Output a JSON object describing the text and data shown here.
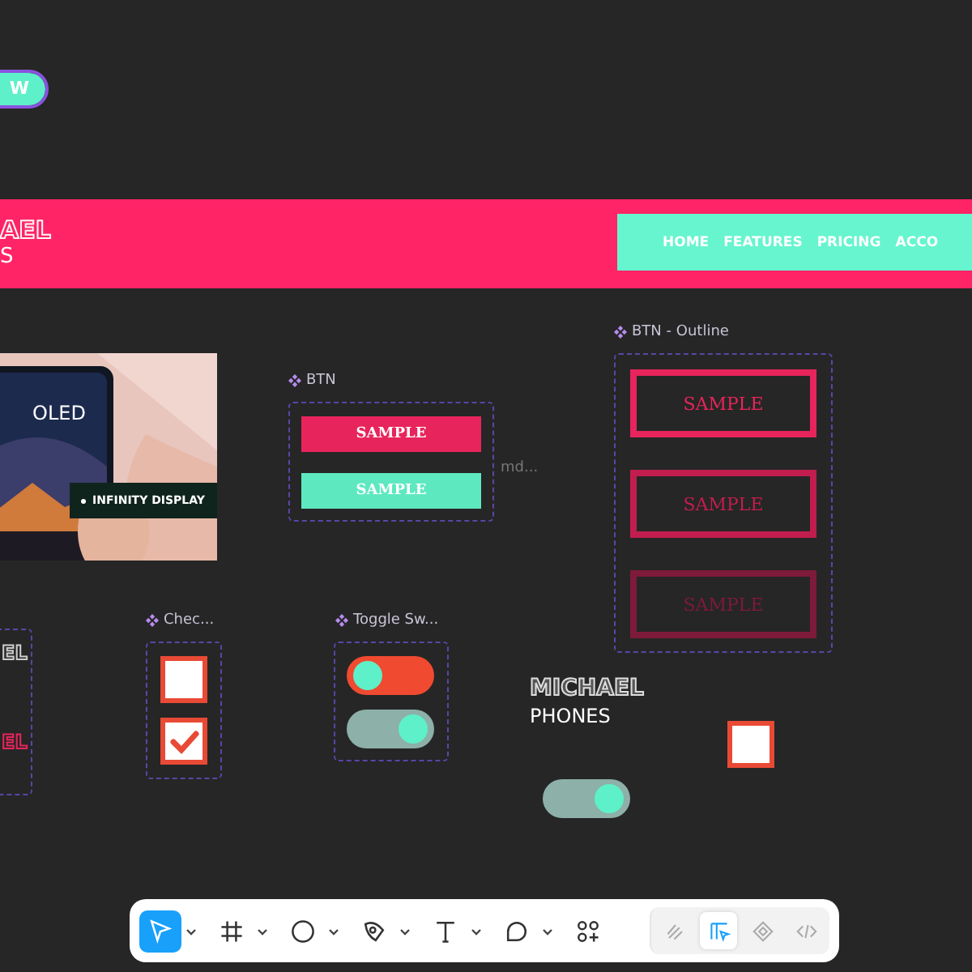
{
  "chip": {
    "label": "W",
    "selected": true
  },
  "header": {
    "logo_top": "AEL",
    "logo_bottom": "S",
    "nav": [
      "HOME",
      "FEATURES",
      "PRICING",
      "ACCO"
    ]
  },
  "banner": {
    "kind": "picture",
    "title": "OLED",
    "badge": "INFINITY DISPLAY"
  },
  "left_frame": {
    "texts": [
      {
        "label": "EL",
        "kind": "outline"
      },
      {
        "label": "EL",
        "kind": "pink"
      }
    ]
  },
  "btn_component": {
    "label": "BTN",
    "buttons": [
      {
        "label": "SAMPLE",
        "kind": "pink"
      },
      {
        "label": "SAMPLE",
        "kind": "teal"
      }
    ],
    "side_note": "md..."
  },
  "outline_component": {
    "label": "BTN - Outline",
    "buttons": [
      {
        "label": "SAMPLE",
        "kind": "strong"
      },
      {
        "label": "SAMPLE",
        "kind": "medium"
      },
      {
        "label": "SAMPLE",
        "kind": "faint"
      }
    ]
  },
  "checkbox_component": {
    "label": "Chec...",
    "boxes": [
      {
        "checked": false
      },
      {
        "checked": true
      }
    ]
  },
  "toggle_component": {
    "label": "Toggle Sw...",
    "toggles": [
      {
        "on": false
      },
      {
        "on": true
      }
    ]
  },
  "logo": {
    "top": "MICHAEL",
    "bottom": "PHONES"
  },
  "loose_checkbox": {
    "checked": false
  },
  "loose_toggle": {
    "on": true
  },
  "toolbar": {
    "tools": [
      {
        "kind": "move",
        "selected": true
      },
      {
        "kind": "frame",
        "selected": false
      },
      {
        "kind": "ellipse",
        "selected": false
      },
      {
        "kind": "pen",
        "selected": false
      },
      {
        "kind": "text",
        "selected": false
      },
      {
        "kind": "comment",
        "selected": false
      },
      {
        "kind": "plugins",
        "selected": false
      }
    ],
    "modes": [
      {
        "kind": "draw",
        "selected": false
      },
      {
        "kind": "design",
        "selected": true
      },
      {
        "kind": "component",
        "selected": false
      },
      {
        "kind": "code",
        "selected": false
      }
    ]
  }
}
